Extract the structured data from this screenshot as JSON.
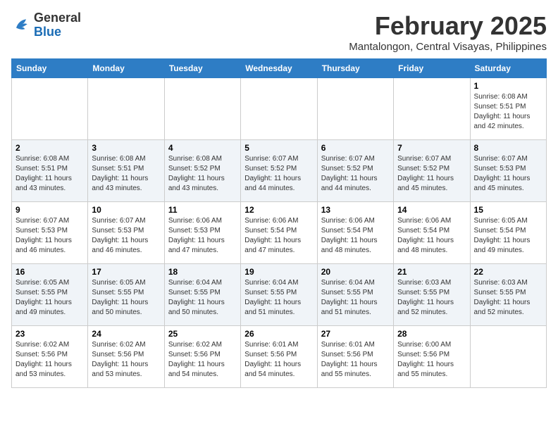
{
  "header": {
    "logo_general": "General",
    "logo_blue": "Blue",
    "month_title": "February 2025",
    "location": "Mantalongon, Central Visayas, Philippines"
  },
  "weekdays": [
    "Sunday",
    "Monday",
    "Tuesday",
    "Wednesday",
    "Thursday",
    "Friday",
    "Saturday"
  ],
  "weeks": [
    [
      {
        "day": "",
        "info": ""
      },
      {
        "day": "",
        "info": ""
      },
      {
        "day": "",
        "info": ""
      },
      {
        "day": "",
        "info": ""
      },
      {
        "day": "",
        "info": ""
      },
      {
        "day": "",
        "info": ""
      },
      {
        "day": "1",
        "info": "Sunrise: 6:08 AM\nSunset: 5:51 PM\nDaylight: 11 hours and 42 minutes."
      }
    ],
    [
      {
        "day": "2",
        "info": "Sunrise: 6:08 AM\nSunset: 5:51 PM\nDaylight: 11 hours and 43 minutes."
      },
      {
        "day": "3",
        "info": "Sunrise: 6:08 AM\nSunset: 5:51 PM\nDaylight: 11 hours and 43 minutes."
      },
      {
        "day": "4",
        "info": "Sunrise: 6:08 AM\nSunset: 5:52 PM\nDaylight: 11 hours and 43 minutes."
      },
      {
        "day": "5",
        "info": "Sunrise: 6:07 AM\nSunset: 5:52 PM\nDaylight: 11 hours and 44 minutes."
      },
      {
        "day": "6",
        "info": "Sunrise: 6:07 AM\nSunset: 5:52 PM\nDaylight: 11 hours and 44 minutes."
      },
      {
        "day": "7",
        "info": "Sunrise: 6:07 AM\nSunset: 5:52 PM\nDaylight: 11 hours and 45 minutes."
      },
      {
        "day": "8",
        "info": "Sunrise: 6:07 AM\nSunset: 5:53 PM\nDaylight: 11 hours and 45 minutes."
      }
    ],
    [
      {
        "day": "9",
        "info": "Sunrise: 6:07 AM\nSunset: 5:53 PM\nDaylight: 11 hours and 46 minutes."
      },
      {
        "day": "10",
        "info": "Sunrise: 6:07 AM\nSunset: 5:53 PM\nDaylight: 11 hours and 46 minutes."
      },
      {
        "day": "11",
        "info": "Sunrise: 6:06 AM\nSunset: 5:53 PM\nDaylight: 11 hours and 47 minutes."
      },
      {
        "day": "12",
        "info": "Sunrise: 6:06 AM\nSunset: 5:54 PM\nDaylight: 11 hours and 47 minutes."
      },
      {
        "day": "13",
        "info": "Sunrise: 6:06 AM\nSunset: 5:54 PM\nDaylight: 11 hours and 48 minutes."
      },
      {
        "day": "14",
        "info": "Sunrise: 6:06 AM\nSunset: 5:54 PM\nDaylight: 11 hours and 48 minutes."
      },
      {
        "day": "15",
        "info": "Sunrise: 6:05 AM\nSunset: 5:54 PM\nDaylight: 11 hours and 49 minutes."
      }
    ],
    [
      {
        "day": "16",
        "info": "Sunrise: 6:05 AM\nSunset: 5:55 PM\nDaylight: 11 hours and 49 minutes."
      },
      {
        "day": "17",
        "info": "Sunrise: 6:05 AM\nSunset: 5:55 PM\nDaylight: 11 hours and 50 minutes."
      },
      {
        "day": "18",
        "info": "Sunrise: 6:04 AM\nSunset: 5:55 PM\nDaylight: 11 hours and 50 minutes."
      },
      {
        "day": "19",
        "info": "Sunrise: 6:04 AM\nSunset: 5:55 PM\nDaylight: 11 hours and 51 minutes."
      },
      {
        "day": "20",
        "info": "Sunrise: 6:04 AM\nSunset: 5:55 PM\nDaylight: 11 hours and 51 minutes."
      },
      {
        "day": "21",
        "info": "Sunrise: 6:03 AM\nSunset: 5:55 PM\nDaylight: 11 hours and 52 minutes."
      },
      {
        "day": "22",
        "info": "Sunrise: 6:03 AM\nSunset: 5:55 PM\nDaylight: 11 hours and 52 minutes."
      }
    ],
    [
      {
        "day": "23",
        "info": "Sunrise: 6:02 AM\nSunset: 5:56 PM\nDaylight: 11 hours and 53 minutes."
      },
      {
        "day": "24",
        "info": "Sunrise: 6:02 AM\nSunset: 5:56 PM\nDaylight: 11 hours and 53 minutes."
      },
      {
        "day": "25",
        "info": "Sunrise: 6:02 AM\nSunset: 5:56 PM\nDaylight: 11 hours and 54 minutes."
      },
      {
        "day": "26",
        "info": "Sunrise: 6:01 AM\nSunset: 5:56 PM\nDaylight: 11 hours and 54 minutes."
      },
      {
        "day": "27",
        "info": "Sunrise: 6:01 AM\nSunset: 5:56 PM\nDaylight: 11 hours and 55 minutes."
      },
      {
        "day": "28",
        "info": "Sunrise: 6:00 AM\nSunset: 5:56 PM\nDaylight: 11 hours and 55 minutes."
      },
      {
        "day": "",
        "info": ""
      }
    ]
  ]
}
